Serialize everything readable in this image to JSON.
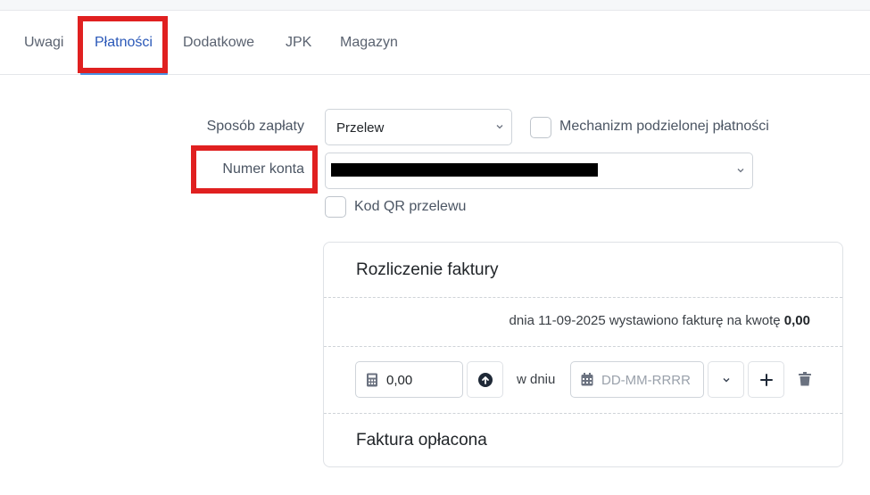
{
  "tabs": [
    {
      "label": "Uwagi",
      "active": false
    },
    {
      "label": "Płatności",
      "active": true
    },
    {
      "label": "Dodatkowe",
      "active": false
    },
    {
      "label": "JPK",
      "active": false
    },
    {
      "label": "Magazyn",
      "active": false
    }
  ],
  "payment": {
    "method_label": "Sposób zapłaty",
    "method_value": "Przelew",
    "split_payment_label": "Mechanizm podzielonej płatności",
    "split_payment_checked": false,
    "account_label": "Numer konta",
    "qr_label": "Kod QR przelewu",
    "qr_checked": false
  },
  "settlement": {
    "title": "Rozliczenie faktury",
    "info_text": "dnia 11-09-2025 wystawiono fakturę na kwotę",
    "info_amount": "0,00",
    "amount_value": "0,00",
    "on_day_label": "w dniu",
    "date_placeholder": "DD-MM-RRRR",
    "paid_title": "Faktura opłacona"
  },
  "colors": {
    "active_tab": "#2a58b8",
    "tab_underline": "#4a90e2",
    "highlight": "#e02020"
  },
  "icons": [
    "chevron-down-icon",
    "calculator-icon",
    "arrow-up-circle-icon",
    "calendar-icon",
    "plus-icon",
    "trash-icon"
  ]
}
